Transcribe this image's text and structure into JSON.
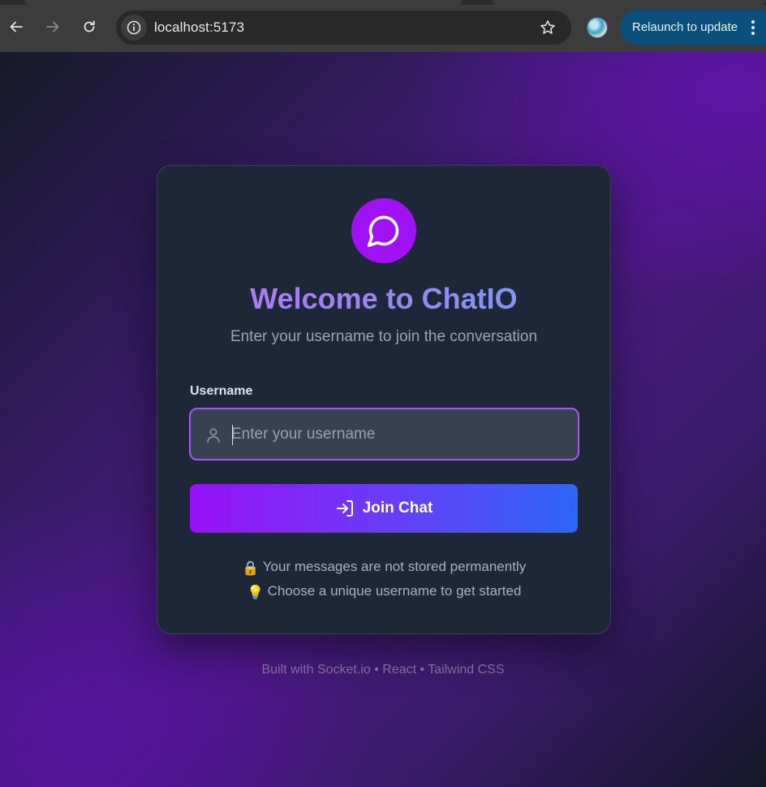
{
  "browser": {
    "url": "localhost:5173",
    "update_button": "Relaunch to update",
    "icons": {
      "back": "arrow-left-icon",
      "forward": "arrow-right-icon",
      "reload": "reload-icon",
      "site_info": "info-icon",
      "bookmark": "star-icon",
      "profile": "avatar",
      "menu": "kebab-menu-icon"
    }
  },
  "login": {
    "logo_icon": "chat-bubble-icon",
    "title": "Welcome to ChatIO",
    "subtitle": "Enter your username to join the conversation",
    "username_label": "Username",
    "username_placeholder": "Enter your username",
    "username_value": "",
    "join_button": "Join Chat",
    "notes": [
      {
        "icon": "lock-icon",
        "emoji": "🔒",
        "text": "Your messages are not stored permanently"
      },
      {
        "icon": "lightbulb-icon",
        "emoji": "💡",
        "text": "Choose a unique username to get started"
      }
    ]
  },
  "footer": {
    "text": "Built with Socket.io • React • Tailwind CSS"
  },
  "colors": {
    "accent_purple": "#a111f5",
    "button_gradient_start": "#9811f6",
    "button_gradient_end": "#2d66f6",
    "card_bg": "#1e2737",
    "input_border": "#a855f7",
    "chrome_update_bg": "#0b4f7d"
  }
}
